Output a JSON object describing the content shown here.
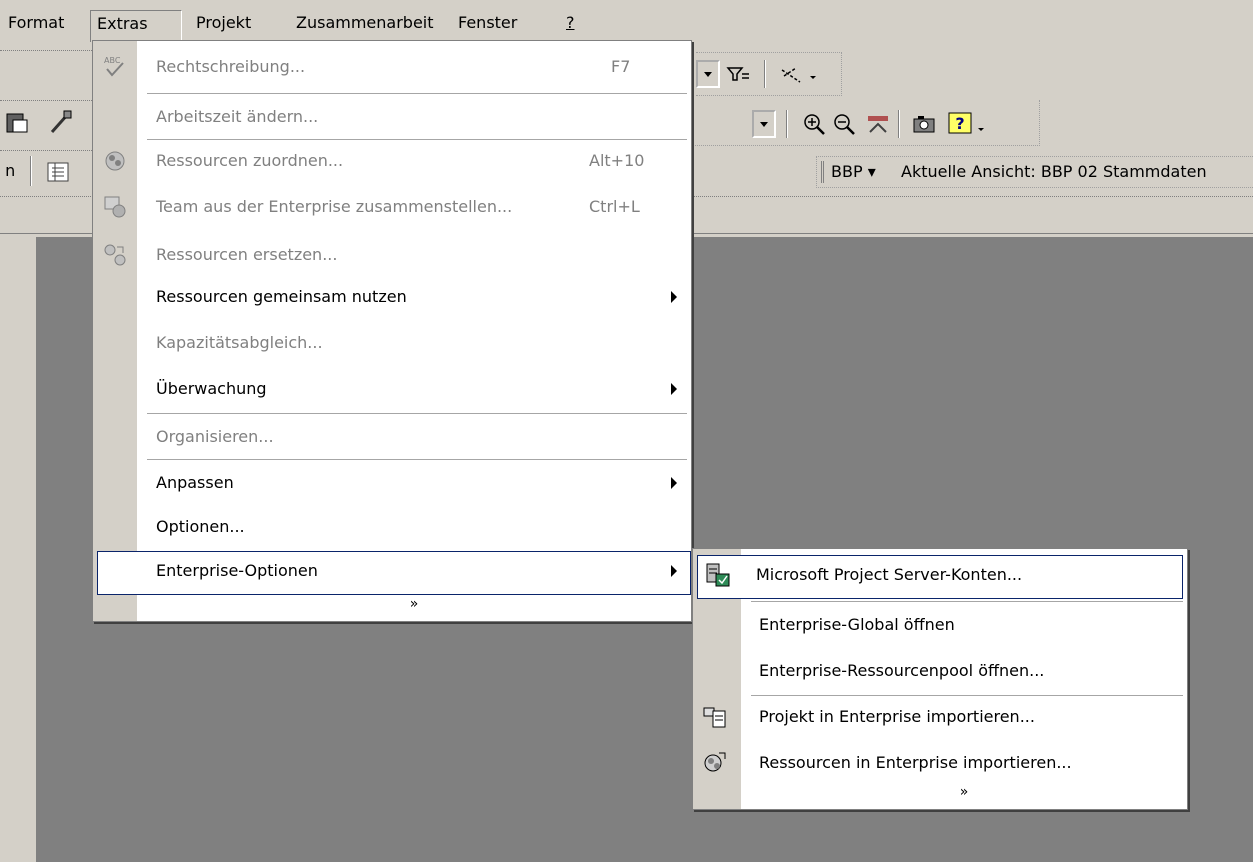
{
  "menubar": {
    "format": "Format",
    "extras": "Extras",
    "projekt": "Projekt",
    "zusammenarbeit": "Zusammenarbeit",
    "fenster": "Fenster",
    "help": "?"
  },
  "toolbar": {
    "resource_dropdown": "BBP ▾",
    "current_view_label": "Aktuelle Ansicht: BBP 02 Stammdaten"
  },
  "extras_menu": {
    "items": [
      {
        "label": "Rechtschreibung...",
        "shortcut": "F7",
        "enabled": false,
        "icon": "spellcheck-icon"
      },
      {
        "label": "Arbeitszeit ändern...",
        "enabled": false
      },
      {
        "label": "Ressourcen zuordnen...",
        "shortcut": "Alt+10",
        "enabled": false,
        "icon": "assign-resources-icon"
      },
      {
        "label": "Team aus der Enterprise zusammenstellen...",
        "shortcut": "Ctrl+L",
        "enabled": false,
        "icon": "build-team-icon"
      },
      {
        "label": "Ressourcen ersetzen...",
        "enabled": false,
        "icon": "substitute-resources-icon"
      },
      {
        "label": "Ressourcen gemeinsam nutzen",
        "enabled": true,
        "submenu": true
      },
      {
        "label": "Kapazitätsabgleich...",
        "enabled": false
      },
      {
        "label": "Überwachung",
        "enabled": true,
        "submenu": true
      },
      {
        "label": "Organisieren...",
        "enabled": false
      },
      {
        "label": "Anpassen",
        "enabled": true,
        "submenu": true
      },
      {
        "label": "Optionen...",
        "enabled": true
      },
      {
        "label": "Enterprise-Optionen",
        "enabled": true,
        "submenu": true,
        "highlighted": true
      }
    ],
    "expand_chevron": "»"
  },
  "enterprise_submenu": {
    "items": [
      {
        "label": "Microsoft Project Server-Konten...",
        "icon": "server-accounts-icon",
        "highlighted": true
      },
      {
        "label": "Enterprise-Global öffnen"
      },
      {
        "label": "Enterprise-Ressourcenpool öffnen..."
      },
      {
        "label": "Projekt in Enterprise importieren...",
        "icon": "import-project-icon"
      },
      {
        "label": "Ressourcen in Enterprise importieren...",
        "icon": "import-resources-icon"
      }
    ],
    "expand_chevron": "»"
  },
  "colors": {
    "chrome": "#d4d0c8",
    "workspace": "#808080",
    "menu_bg": "#ffffff",
    "highlight_border": "#0a246a",
    "disabled_text": "#808080"
  }
}
